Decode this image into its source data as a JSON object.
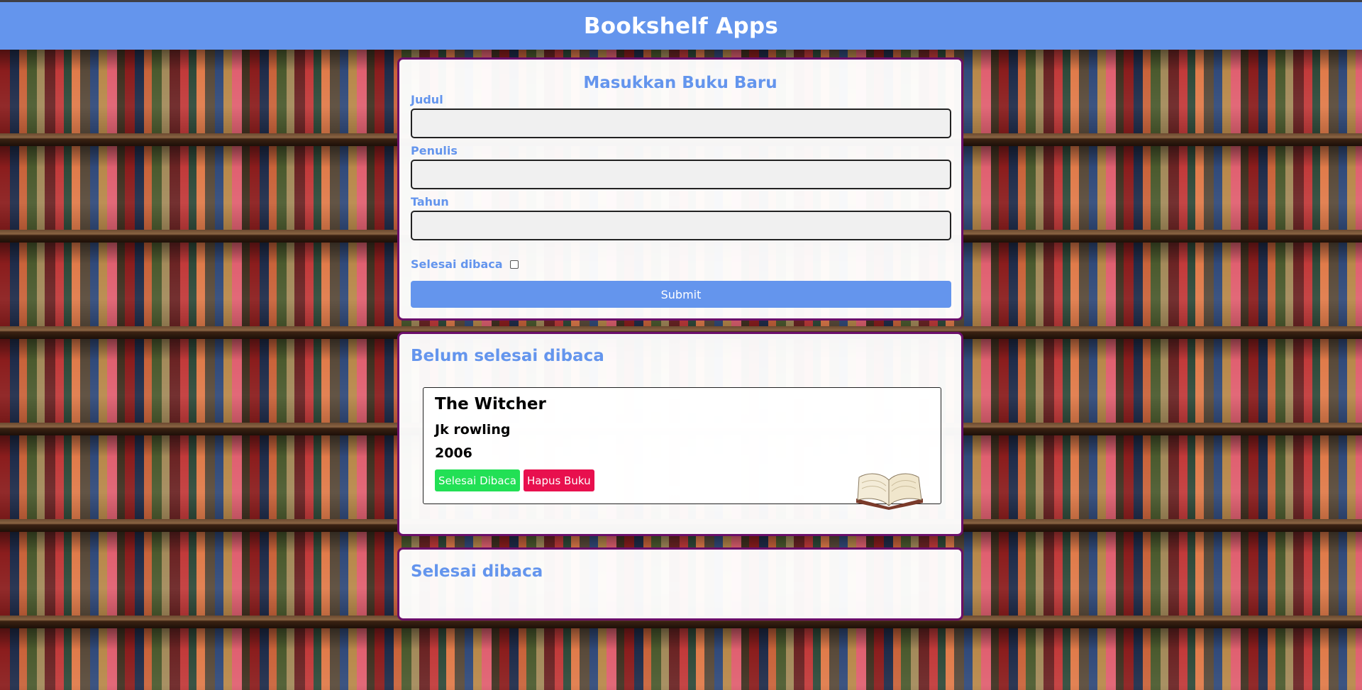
{
  "header": {
    "title": "Bookshelf Apps"
  },
  "form": {
    "title": "Masukkan Buku Baru",
    "title_label": "Judul",
    "title_value": "",
    "author_label": "Penulis",
    "author_value": "",
    "year_label": "Tahun",
    "year_value": "",
    "complete_label": "Selesai dibaca",
    "complete_checked": false,
    "submit_label": "Submit"
  },
  "incomplete": {
    "title": "Belum selesai dibaca",
    "books": [
      {
        "title": "The Witcher",
        "author": "Jk rowling",
        "year": "2006",
        "done_label": "Selesai Dibaca",
        "delete_label": "Hapus Buku",
        "icon": "open-book-icon"
      }
    ]
  },
  "complete": {
    "title": "Selesai dibaca",
    "books": []
  },
  "colors": {
    "accent": "#6495ed",
    "panel_border": "#6a0e6a",
    "done_button": "#22e055",
    "delete_button": "#e8104e"
  }
}
